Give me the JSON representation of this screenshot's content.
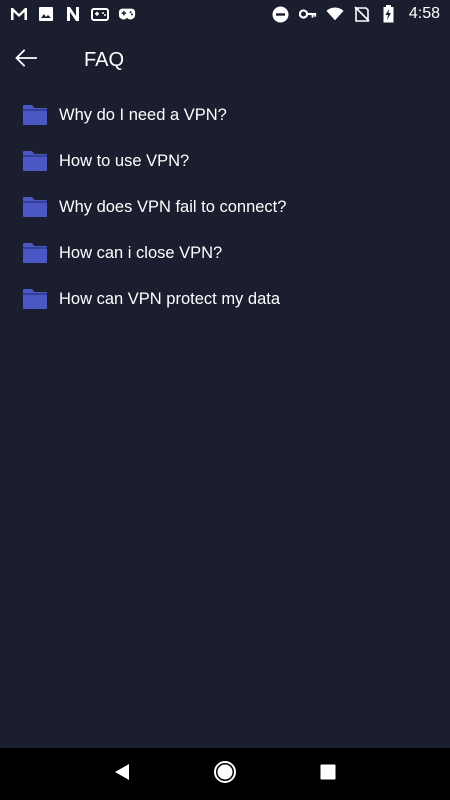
{
  "status_bar": {
    "time": "4:58",
    "left_icons": [
      "gmail-icon",
      "image-icon",
      "n-app-icon",
      "game-controller-icon",
      "gamepad-icon"
    ],
    "right_icons": [
      "do-not-disturb-icon",
      "vpn-key-icon",
      "wifi-icon",
      "no-sim-icon",
      "battery-charging-icon"
    ]
  },
  "toolbar": {
    "title": "FAQ",
    "back_icon": "arrow-left-icon"
  },
  "faq": {
    "items": [
      {
        "label": "Why do I need a VPN?",
        "icon": "folder-icon"
      },
      {
        "label": "How to use VPN?",
        "icon": "folder-icon"
      },
      {
        "label": "Why does VPN fail to connect?",
        "icon": "folder-icon"
      },
      {
        "label": "How can i close VPN?",
        "icon": "folder-icon"
      },
      {
        "label": "How can VPN protect my data",
        "icon": "folder-icon"
      }
    ]
  },
  "nav_bar": {
    "buttons": [
      "back-triangle-icon",
      "home-circle-icon",
      "recents-square-icon"
    ]
  },
  "colors": {
    "background": "#1b1e2f",
    "folder": "#4a57c4",
    "nav_bar": "#000000",
    "text": "#ffffff"
  }
}
